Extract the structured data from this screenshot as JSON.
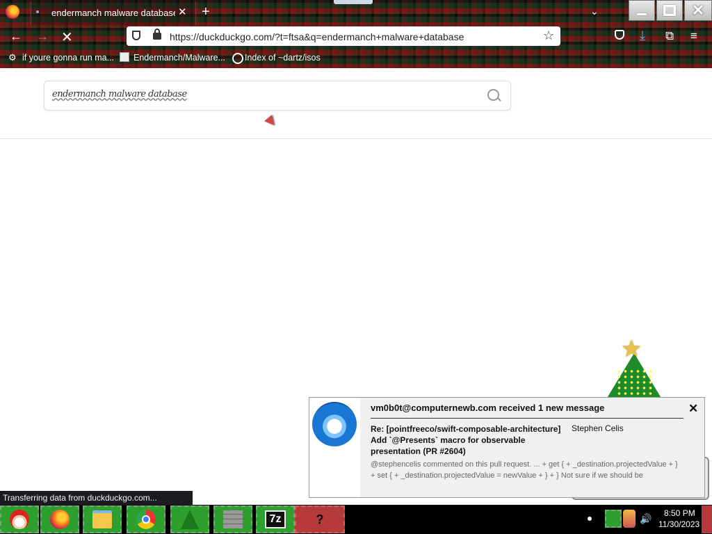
{
  "browser": {
    "tab_title": "endermanch malware database at",
    "tab_close_glyph": "✕",
    "new_tab_glyph": "+",
    "tab_list_glyph": "⌄",
    "url": "https://duckduckgo.com/?t=ftsa&q=endermanch+malware+database",
    "nav": {
      "back_glyph": "←",
      "forward_glyph": "→",
      "stop_glyph": "✕",
      "star_glyph": "☆",
      "download_glyph": "⤓",
      "extensions_glyph": "⧉",
      "menu_glyph": "≡"
    },
    "bookmarks": [
      {
        "label": "if youre gonna run ma...",
        "icon": "robot-icon"
      },
      {
        "label": "Endermanch/Malware...",
        "icon": "page-icon"
      },
      {
        "label": "Index of ~dartz/isos",
        "icon": "globe-icon"
      }
    ],
    "status": "Transferring data from duckduckgo.com..."
  },
  "page": {
    "search_query": "endermanch malware database"
  },
  "notification": {
    "title": "vm0b0t@computernewb.com received 1 new message",
    "close_glyph": "✕",
    "subject": "Re: [pointfreeco/swift-composable-architecture] Add `@Presents` macro for observable presentation (PR #2604)",
    "from": "Stephen Celis",
    "body": "@stephencelis commented on this pull request. ... + get { + _destination.projectedValue + } + set { + _destination.projectedValue = newValue + } + } Not sure if we should be"
  },
  "taskbar": {
    "items": [
      "start-santa",
      "firefox",
      "file-explorer",
      "chrome",
      "christmas-tree",
      "brick-wall",
      "7-zip",
      "unknown-app"
    ],
    "sz_label": "7z",
    "red_label": "?",
    "volume_glyph": "🔊",
    "clock_time": "8:50 PM",
    "clock_date": "11/30/2023"
  },
  "colors": {
    "tartan_red": "#961414",
    "tartan_green": "#143c1e",
    "taskbar_green": "#2e9e2e",
    "taskbar_red": "#b73a3a",
    "download_blue": "#4db6f0"
  }
}
